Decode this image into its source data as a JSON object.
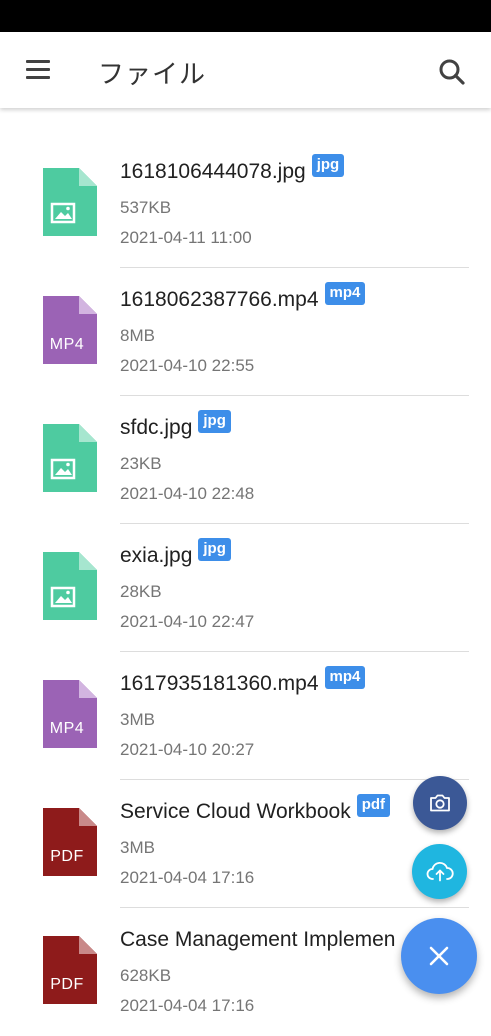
{
  "app_bar": {
    "title": "ファイル"
  },
  "files": [
    {
      "name": "1618106444078.jpg",
      "ext": "jpg",
      "type": "image",
      "size": "537KB",
      "date": "2021-04-11 11:00"
    },
    {
      "name": "1618062387766.mp4",
      "ext": "mp4",
      "type": "video",
      "icon_label": "MP4",
      "size": "8MB",
      "date": "2021-04-10 22:55"
    },
    {
      "name": "sfdc.jpg",
      "ext": "jpg",
      "type": "image",
      "size": "23KB",
      "date": "2021-04-10 22:48"
    },
    {
      "name": "exia.jpg",
      "ext": "jpg",
      "type": "image",
      "size": "28KB",
      "date": "2021-04-10 22:47"
    },
    {
      "name": "1617935181360.mp4",
      "ext": "mp4",
      "type": "video",
      "icon_label": "MP4",
      "size": "3MB",
      "date": "2021-04-10 20:27"
    },
    {
      "name": "Service Cloud Workbook",
      "ext": "pdf",
      "type": "pdf",
      "icon_label": "PDF",
      "size": "3MB",
      "date": "2021-04-04 17:16"
    },
    {
      "name": "Case Management Implemen",
      "ext": "",
      "type": "pdf",
      "icon_label": "PDF",
      "size": "628KB",
      "date": "2021-04-04 17:16"
    }
  ],
  "colors": {
    "image_icon": "#4ecba0",
    "video_icon": "#9b63b5",
    "pdf_icon": "#8e1b1b",
    "badge": "#3d8ee9",
    "fab_camera": "#3b5896",
    "fab_upload": "#1fb6e0",
    "fab_main": "#4a8fef"
  },
  "icons": {
    "menu": "hamburger-menu-icon",
    "search": "search-icon",
    "camera": "camera-icon",
    "upload": "cloud-upload-icon",
    "close": "close-icon"
  }
}
